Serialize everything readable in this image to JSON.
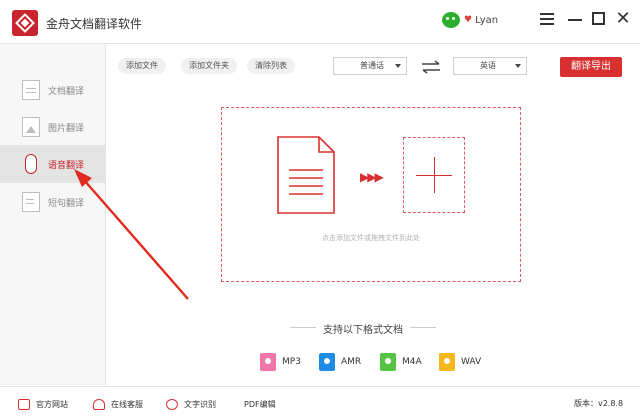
{
  "app": {
    "title": "金舟文档翻译软件",
    "username": "Lyan"
  },
  "sidebar": {
    "items": [
      {
        "label": "文档翻译",
        "icon": "document-icon",
        "active": false
      },
      {
        "label": "图片翻译",
        "icon": "image-icon",
        "active": false
      },
      {
        "label": "语音翻译",
        "icon": "microphone-icon",
        "active": true
      },
      {
        "label": "短句翻译",
        "icon": "short-text-icon",
        "active": false
      }
    ]
  },
  "toolbar": {
    "add_file": "添加文件",
    "add_folder": "添加文件夹",
    "clear_list": "清除列表",
    "source_language": "普通话",
    "target_language": "英语",
    "export": "翻译导出"
  },
  "dropzone": {
    "hint": "点击添加文件或拖拽文件到此处"
  },
  "formats": {
    "title": "支持以下格式文档",
    "items": [
      {
        "label": "MP3",
        "icon": "mp3-icon",
        "color": "#f075a8"
      },
      {
        "label": "AMR",
        "icon": "amr-icon",
        "color": "#1f8ce6"
      },
      {
        "label": "M4A",
        "icon": "m4a-icon",
        "color": "#55c443"
      },
      {
        "label": "WAV",
        "icon": "wav-icon",
        "color": "#f5b719"
      }
    ]
  },
  "bottom": {
    "website": "官方网站",
    "support": "在线客服",
    "ocr": "文字识别",
    "pdf_edit": "PDF编辑",
    "version": "版本：v2.8.8"
  },
  "colors": {
    "accent": "#d9302f",
    "logo": "#c9252c"
  }
}
